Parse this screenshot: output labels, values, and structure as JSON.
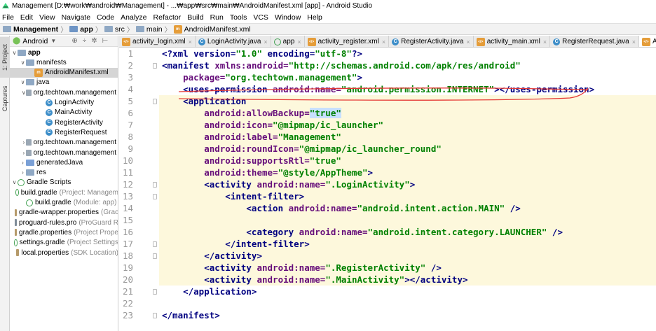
{
  "window": {
    "title": "Management [D:₩work₩android₩Management] - ...₩app₩src₩main₩AndroidManifest.xml [app] - Android Studio"
  },
  "menu": [
    "File",
    "Edit",
    "View",
    "Navigate",
    "Code",
    "Analyze",
    "Refactor",
    "Build",
    "Run",
    "Tools",
    "VCS",
    "Window",
    "Help"
  ],
  "breadcrumb": [
    "Management",
    "app",
    "src",
    "main",
    "AndroidManifest.xml"
  ],
  "toolwindows": [
    "1: Project",
    "Captures"
  ],
  "panel": {
    "view": "Android"
  },
  "tree": [
    {
      "label": "app",
      "sub": ""
    },
    {
      "label": "manifests",
      "sub": ""
    },
    {
      "label": "AndroidManifest.xml",
      "sub": ""
    },
    {
      "label": "java",
      "sub": ""
    },
    {
      "label": "org.techtown.management",
      "sub": ""
    },
    {
      "label": "LoginActivity",
      "sub": ""
    },
    {
      "label": "MainActivity",
      "sub": ""
    },
    {
      "label": "RegisterActivity",
      "sub": ""
    },
    {
      "label": "RegisterRequest",
      "sub": ""
    },
    {
      "label": "org.techtown.management",
      "sub": ""
    },
    {
      "label": "org.techtown.management",
      "sub": ""
    },
    {
      "label": "generatedJava",
      "sub": ""
    },
    {
      "label": "res",
      "sub": ""
    },
    {
      "label": "Gradle Scripts",
      "sub": ""
    },
    {
      "label": "build.gradle",
      "sub": "(Project: Managem"
    },
    {
      "label": "build.gradle",
      "sub": "(Module: app)"
    },
    {
      "label": "gradle-wrapper.properties",
      "sub": "(Grac"
    },
    {
      "label": "proguard-rules.pro",
      "sub": "(ProGuard R"
    },
    {
      "label": "gradle.properties",
      "sub": "(Project Prope"
    },
    {
      "label": "settings.gradle",
      "sub": "(Project Settings"
    },
    {
      "label": "local.properties",
      "sub": "(SDK Location)"
    }
  ],
  "tabs": [
    "activity_login.xml",
    "LoginActivity.java",
    "app",
    "activity_register.xml",
    "RegisterActivity.java",
    "activity_main.xml",
    "RegisterRequest.java",
    "AndroidManifest.xml"
  ],
  "line_numbers": [
    "1",
    "2",
    "3",
    "4",
    "5",
    "6",
    "7",
    "8",
    "9",
    "10",
    "11",
    "12",
    "13",
    "14",
    "15",
    "16",
    "17",
    "18",
    "19",
    "20",
    "21",
    "22",
    "23"
  ],
  "code": [
    [
      {
        "t": "<?xml version=",
        "c": "tag"
      },
      {
        "t": "\"1.0\"",
        "c": "val"
      },
      {
        "t": " encoding=",
        "c": "tag"
      },
      {
        "t": "\"utf-8\"",
        "c": "val"
      },
      {
        "t": "?>",
        "c": "tag"
      }
    ],
    [
      {
        "t": "<manifest ",
        "c": "tag"
      },
      {
        "t": "xmlns:android=",
        "c": "attr"
      },
      {
        "t": "\"http://schemas.android.com/apk/res/android\"",
        "c": "val"
      }
    ],
    [
      {
        "t": "    package=",
        "c": "attr"
      },
      {
        "t": "\"org.techtown.management\"",
        "c": "val"
      },
      {
        "t": ">",
        "c": "tag"
      }
    ],
    [
      {
        "t": "    <uses-permission ",
        "c": "tag"
      },
      {
        "t": "android:name=",
        "c": "attr"
      },
      {
        "t": "\"android.permission.INTERNET\"",
        "c": "val"
      },
      {
        "t": "></uses-permission>",
        "c": "tag"
      }
    ],
    [
      {
        "t": "    <application",
        "c": "tag"
      }
    ],
    [
      {
        "t": "        android:allowBackup=",
        "c": "attr"
      },
      {
        "t": "\"true\"",
        "c": "val"
      }
    ],
    [
      {
        "t": "        android:icon=",
        "c": "attr"
      },
      {
        "t": "\"@mipmap/ic_launcher\"",
        "c": "val"
      }
    ],
    [
      {
        "t": "        android:label=",
        "c": "attr"
      },
      {
        "t": "\"Management\"",
        "c": "val"
      }
    ],
    [
      {
        "t": "        android:roundIcon=",
        "c": "attr"
      },
      {
        "t": "\"@mipmap/ic_launcher_round\"",
        "c": "val"
      }
    ],
    [
      {
        "t": "        android:supportsRtl=",
        "c": "attr"
      },
      {
        "t": "\"true\"",
        "c": "val"
      }
    ],
    [
      {
        "t": "        android:theme=",
        "c": "attr"
      },
      {
        "t": "\"@style/AppTheme\"",
        "c": "val"
      },
      {
        "t": ">",
        "c": "tag"
      }
    ],
    [
      {
        "t": "        <activity ",
        "c": "tag"
      },
      {
        "t": "android:name=",
        "c": "attr"
      },
      {
        "t": "\".LoginActivity\"",
        "c": "val"
      },
      {
        "t": ">",
        "c": "tag"
      }
    ],
    [
      {
        "t": "            <intent-filter>",
        "c": "tag"
      }
    ],
    [
      {
        "t": "                <action ",
        "c": "tag"
      },
      {
        "t": "android:name=",
        "c": "attr"
      },
      {
        "t": "\"android.intent.action.MAIN\"",
        "c": "val"
      },
      {
        "t": " />",
        "c": "tag"
      }
    ],
    [
      {
        "t": "",
        "c": "pun"
      }
    ],
    [
      {
        "t": "                <category ",
        "c": "tag"
      },
      {
        "t": "android:name=",
        "c": "attr"
      },
      {
        "t": "\"android.intent.category.LAUNCHER\"",
        "c": "val"
      },
      {
        "t": " />",
        "c": "tag"
      }
    ],
    [
      {
        "t": "            </intent-filter>",
        "c": "tag"
      }
    ],
    [
      {
        "t": "        </activity>",
        "c": "tag"
      }
    ],
    [
      {
        "t": "        <activity ",
        "c": "tag"
      },
      {
        "t": "android:name=",
        "c": "attr"
      },
      {
        "t": "\".RegisterActivity\"",
        "c": "val"
      },
      {
        "t": " />",
        "c": "tag"
      }
    ],
    [
      {
        "t": "        <activity ",
        "c": "tag"
      },
      {
        "t": "android:name=",
        "c": "attr"
      },
      {
        "t": "\".MainActivity\"",
        "c": "val"
      },
      {
        "t": "></activity>",
        "c": "tag"
      }
    ],
    [
      {
        "t": "    </application>",
        "c": "tag"
      }
    ],
    [
      {
        "t": "",
        "c": "pun"
      }
    ],
    [
      {
        "t": "</manifest>",
        "c": "tag"
      }
    ]
  ],
  "colors": {
    "tag": "#000080",
    "attribute": "#660e7a",
    "value": "#008000",
    "highlight_block": "#fdf8dc",
    "annotation": "#e53935"
  }
}
